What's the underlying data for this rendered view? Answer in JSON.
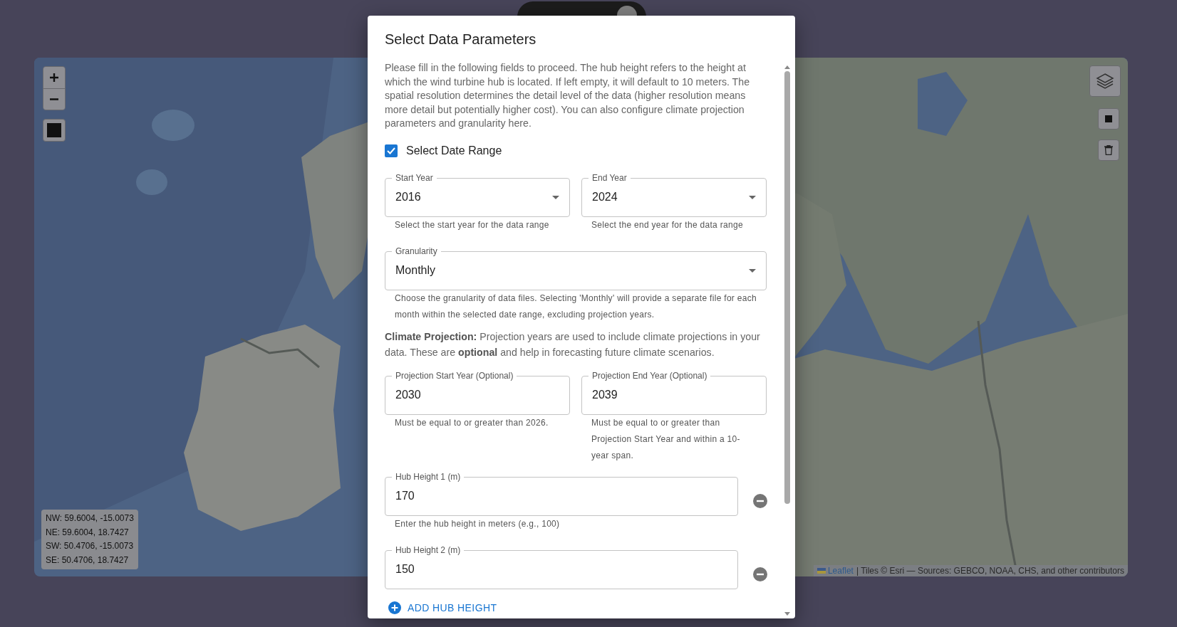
{
  "map": {
    "coordinates": [
      "NW: 59.6004, -15.0073",
      "NE: 59.6004, 18.7427",
      "SW: 50.4706, -15.0073",
      "SE: 50.4706, 18.7427"
    ],
    "attribution": {
      "link": "Leaflet",
      "text": "| Tiles © Esri — Sources: GEBCO, NOAA, CHS, and other contributors"
    }
  },
  "dialog": {
    "title": "Select Data Parameters",
    "description": "Please fill in the following fields to proceed. The hub height refers to the height at which the wind turbine hub is located. If left empty, it will default to 10 meters. The spatial resolution determines the detail level of the data (higher resolution means more detail but potentially higher cost). You can also configure climate projection parameters and granularity here.",
    "date_range": {
      "label": "Select Date Range",
      "checked": true
    },
    "year_fields": [
      {
        "label": "Start Year",
        "value": "2016",
        "helper": "Select the start year for the data range"
      },
      {
        "label": "End Year",
        "value": "2024",
        "helper": "Select the end year for the data range"
      }
    ],
    "granularity": {
      "label": "Granularity",
      "value": "Monthly",
      "helper": "Choose the granularity of data files. Selecting 'Monthly' will provide a separate file for each month within the selected date range, excluding projection years."
    },
    "climate_note": "**Climate Projection:** Projection years are used to include climate projections in your data. These are **optional** and help in forecasting future climate scenarios.",
    "projection_fields": [
      {
        "label": "Projection Start Year (Optional)",
        "value": "2030",
        "helper": "Must be equal to or greater than 2026."
      },
      {
        "label": "Projection End Year (Optional)",
        "value": "2039",
        "helper": "Must be equal to or greater than Projection Start Year and within a 10-year span."
      }
    ],
    "hub_heights": [
      {
        "label": "Hub Height 1 (m)",
        "value": "170",
        "helper": "Enter the hub height in meters (e.g., 100)"
      },
      {
        "label": "Hub Height 2 (m)",
        "value": "150"
      }
    ],
    "add_button": "ADD HUB HEIGHT"
  }
}
